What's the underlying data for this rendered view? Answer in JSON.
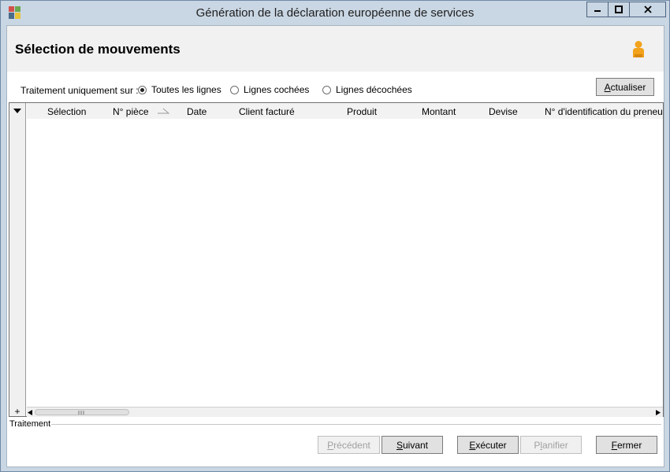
{
  "window": {
    "title": "Génération de la déclaration européenne de services",
    "controls": {
      "minimize": "minimize-icon",
      "maximize": "maximize-icon",
      "close": "close-icon"
    }
  },
  "header": {
    "title": "Sélection de mouvements",
    "user_icon": "user-icon"
  },
  "filter": {
    "label": "Traitement uniquement sur :",
    "options": [
      {
        "label": "Toutes les lignes",
        "selected": true
      },
      {
        "label": "Lignes cochées",
        "selected": false
      },
      {
        "label": "Lignes décochées",
        "selected": false
      }
    ],
    "refresh_label_underlined": "A",
    "refresh_label_rest": "ctualiser"
  },
  "grid": {
    "columns": [
      "Sélection",
      "N° pièce",
      "Date",
      "Client facturé",
      "Produit",
      "Montant",
      "Devise",
      "N° d'identification du preneur"
    ],
    "sorted_column": "N° pièce",
    "rows": [],
    "expand_symbol": "+"
  },
  "status": {
    "label": "Traitement"
  },
  "footer": {
    "previous": {
      "u": "P",
      "rest": "récédent",
      "enabled": false
    },
    "next": {
      "u": "S",
      "rest": "uivant",
      "enabled": true
    },
    "execute": {
      "u": "E",
      "rest": "xécuter",
      "enabled": true
    },
    "schedule": {
      "pre": "P",
      "u": "l",
      "rest": "anifier",
      "enabled": false
    },
    "close": {
      "u": "F",
      "rest": "ermer",
      "enabled": true
    }
  },
  "colors": {
    "titlebar": "#c9d6e3",
    "header_bg": "#f1f1f1",
    "button_bg": "#e1e1e1",
    "user_icon": "#f2a21b"
  }
}
